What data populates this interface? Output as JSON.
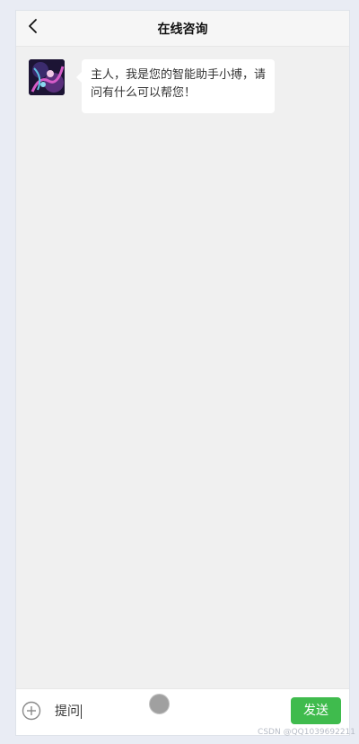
{
  "header": {
    "title": "在线咨询",
    "back_icon": "chevron-left-icon"
  },
  "chat": {
    "messages": [
      {
        "sender": "assistant",
        "avatar": "assistant-avatar",
        "text": "主人，我是您的智能助手小搏，请问有什么可以帮您！"
      }
    ]
  },
  "input_bar": {
    "plus_icon": "plus-circle-icon",
    "input_value": "提问",
    "send_label": "发送"
  },
  "watermark": "CSDN @QQ1039692211",
  "colors": {
    "send_button": "#3fbb4d",
    "page_background": "#f0f0f0",
    "outer_background": "#e9ecf4"
  }
}
